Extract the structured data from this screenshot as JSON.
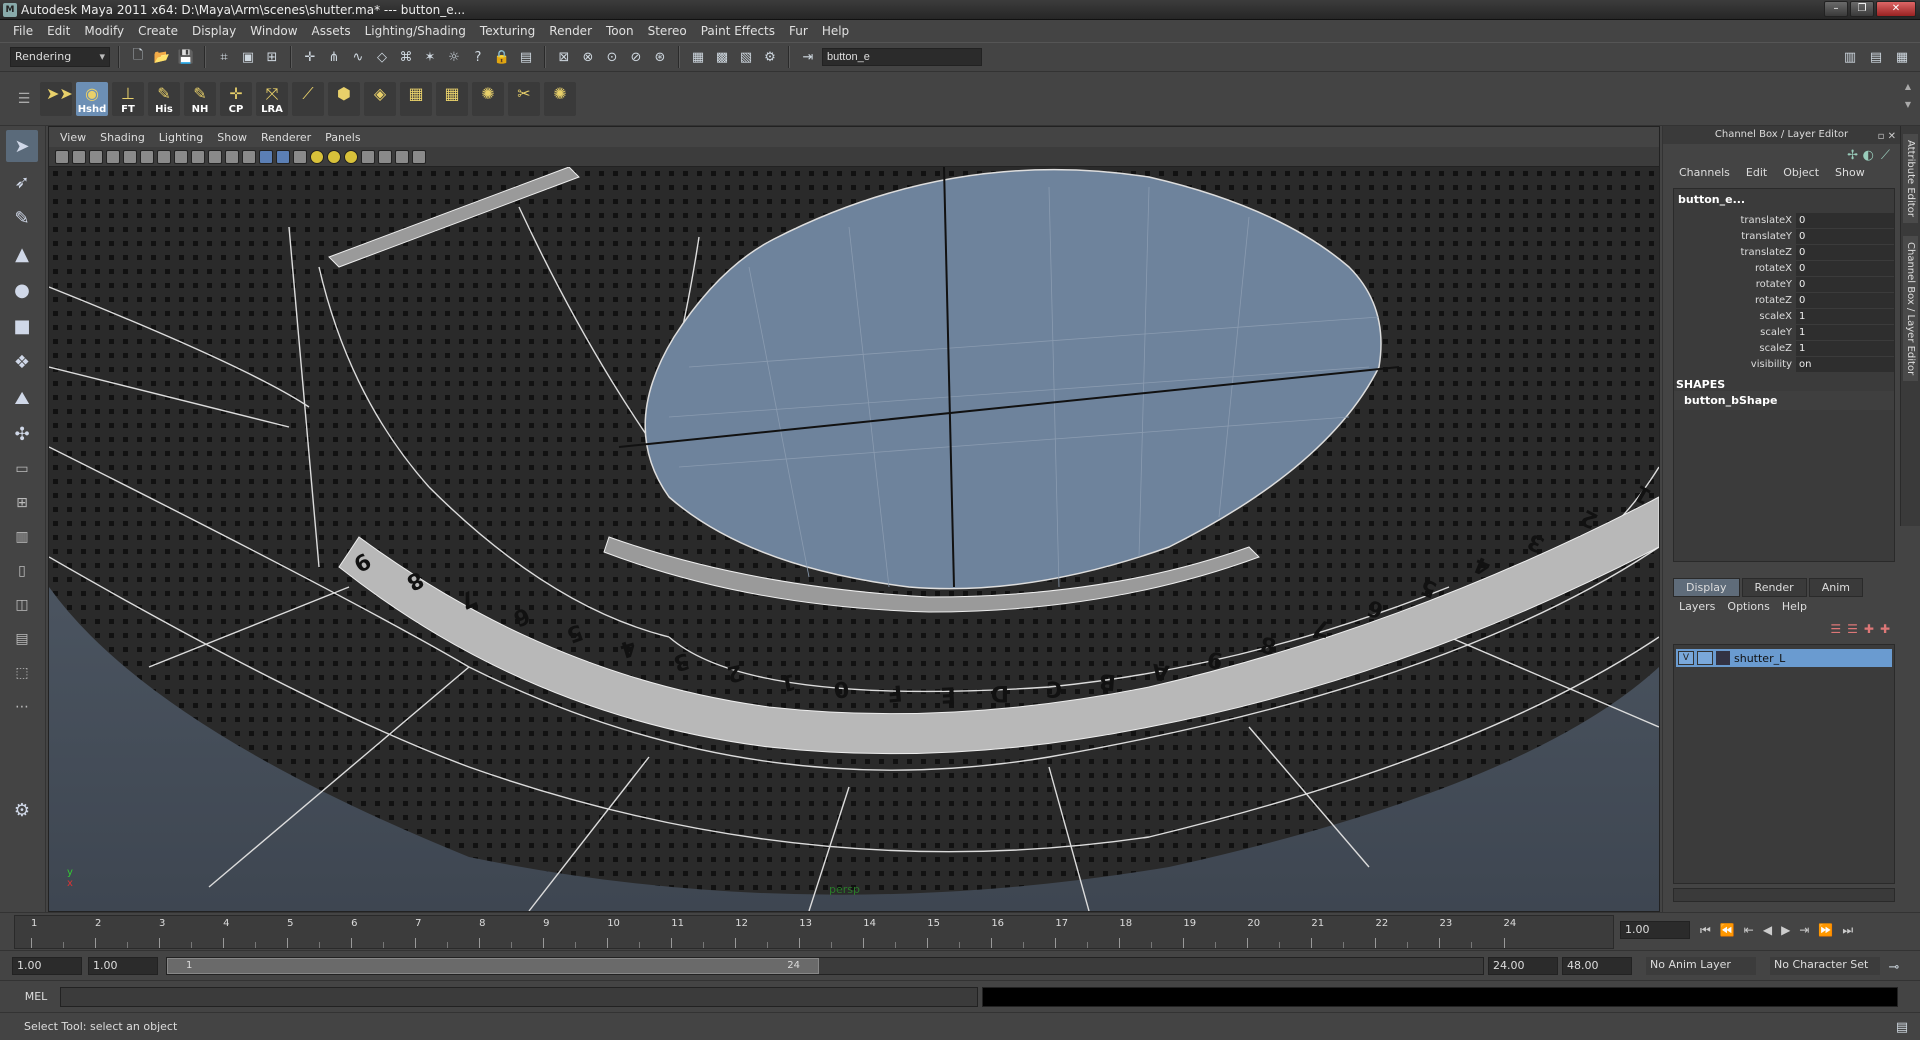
{
  "window": {
    "title": "Autodesk Maya 2011 x64: D:\\Maya\\Arm\\scenes\\shutter.ma*   ---   button_e..."
  },
  "menubar": [
    "File",
    "Edit",
    "Modify",
    "Create",
    "Display",
    "Window",
    "Assets",
    "Lighting/Shading",
    "Texturing",
    "Render",
    "Toon",
    "Stereo",
    "Paint Effects",
    "Fur",
    "Help"
  ],
  "status_line": {
    "menu_set": "Rendering",
    "name_field": "button_e"
  },
  "shelf": {
    "buttons": [
      {
        "label": "",
        "icon": "arrows-icon"
      },
      {
        "label": "Hshd",
        "icon": "hypershade-icon"
      },
      {
        "label": "FT",
        "icon": "freeze-transform-icon"
      },
      {
        "label": "His",
        "icon": "history-icon"
      },
      {
        "label": "NH",
        "icon": "no-history-icon"
      },
      {
        "label": "CP",
        "icon": "center-pivot-icon"
      },
      {
        "label": "LRA",
        "icon": "local-rotation-axes-icon"
      },
      {
        "label": "",
        "icon": "joint-icon"
      },
      {
        "label": "",
        "icon": "blend-icon"
      },
      {
        "label": "",
        "icon": "uv-snapshot-icon"
      },
      {
        "label": "",
        "icon": "uv-layout-icon"
      },
      {
        "label": "",
        "icon": "uv-grid-icon"
      },
      {
        "label": "",
        "icon": "uv-sew-icon"
      },
      {
        "label": "",
        "icon": "uv-cut-icon"
      },
      {
        "label": "",
        "icon": "uv-relax-icon"
      }
    ]
  },
  "panel": {
    "menu": [
      "View",
      "Shading",
      "Lighting",
      "Show",
      "Renderer",
      "Panels"
    ],
    "camera": "persp",
    "axis_y": "y",
    "axis_x": "x",
    "numbers": [
      "9",
      "8",
      "7",
      "6",
      "5",
      "4",
      "3",
      "2",
      "1",
      "0",
      "F",
      "E",
      "D",
      "C",
      "B",
      "A",
      "9",
      "8",
      "7",
      "6",
      "5",
      "4",
      "3",
      "2",
      "1"
    ]
  },
  "channel_box": {
    "title": "Channel Box / Layer Editor",
    "menu": [
      "Channels",
      "Edit",
      "Object",
      "Show"
    ],
    "node": "button_e...",
    "attributes": [
      {
        "name": "translateX",
        "value": "0"
      },
      {
        "name": "translateY",
        "value": "0"
      },
      {
        "name": "translateZ",
        "value": "0"
      },
      {
        "name": "rotateX",
        "value": "0"
      },
      {
        "name": "rotateY",
        "value": "0"
      },
      {
        "name": "rotateZ",
        "value": "0"
      },
      {
        "name": "scaleX",
        "value": "1"
      },
      {
        "name": "scaleY",
        "value": "1"
      },
      {
        "name": "scaleZ",
        "value": "1"
      },
      {
        "name": "visibility",
        "value": "on"
      }
    ],
    "shapes_header": "SHAPES",
    "shape": "button_bShape"
  },
  "layer_editor": {
    "tabs": [
      "Display",
      "Render",
      "Anim"
    ],
    "menu": [
      "Layers",
      "Options",
      "Help"
    ],
    "layers": [
      {
        "visible": "V",
        "name": "shutter_L"
      }
    ]
  },
  "side_tabs": [
    "Attribute Editor",
    "Channel Box / Layer Editor"
  ],
  "time_slider": {
    "ticks": [
      "1",
      "2",
      "3",
      "4",
      "5",
      "6",
      "7",
      "8",
      "9",
      "10",
      "11",
      "12",
      "13",
      "14",
      "15",
      "16",
      "17",
      "18",
      "19",
      "20",
      "21",
      "22",
      "23",
      "24"
    ],
    "current_frame": "1.00"
  },
  "range_slider": {
    "start": "1.00",
    "playback_start": "1.00",
    "handle_start": "1",
    "handle_end": "24",
    "playback_end": "24.00",
    "end": "48.00",
    "anim_layer": "No Anim Layer",
    "character_set": "No Character Set"
  },
  "command_line": {
    "label": "MEL"
  },
  "help_line": "Select Tool: select an object"
}
